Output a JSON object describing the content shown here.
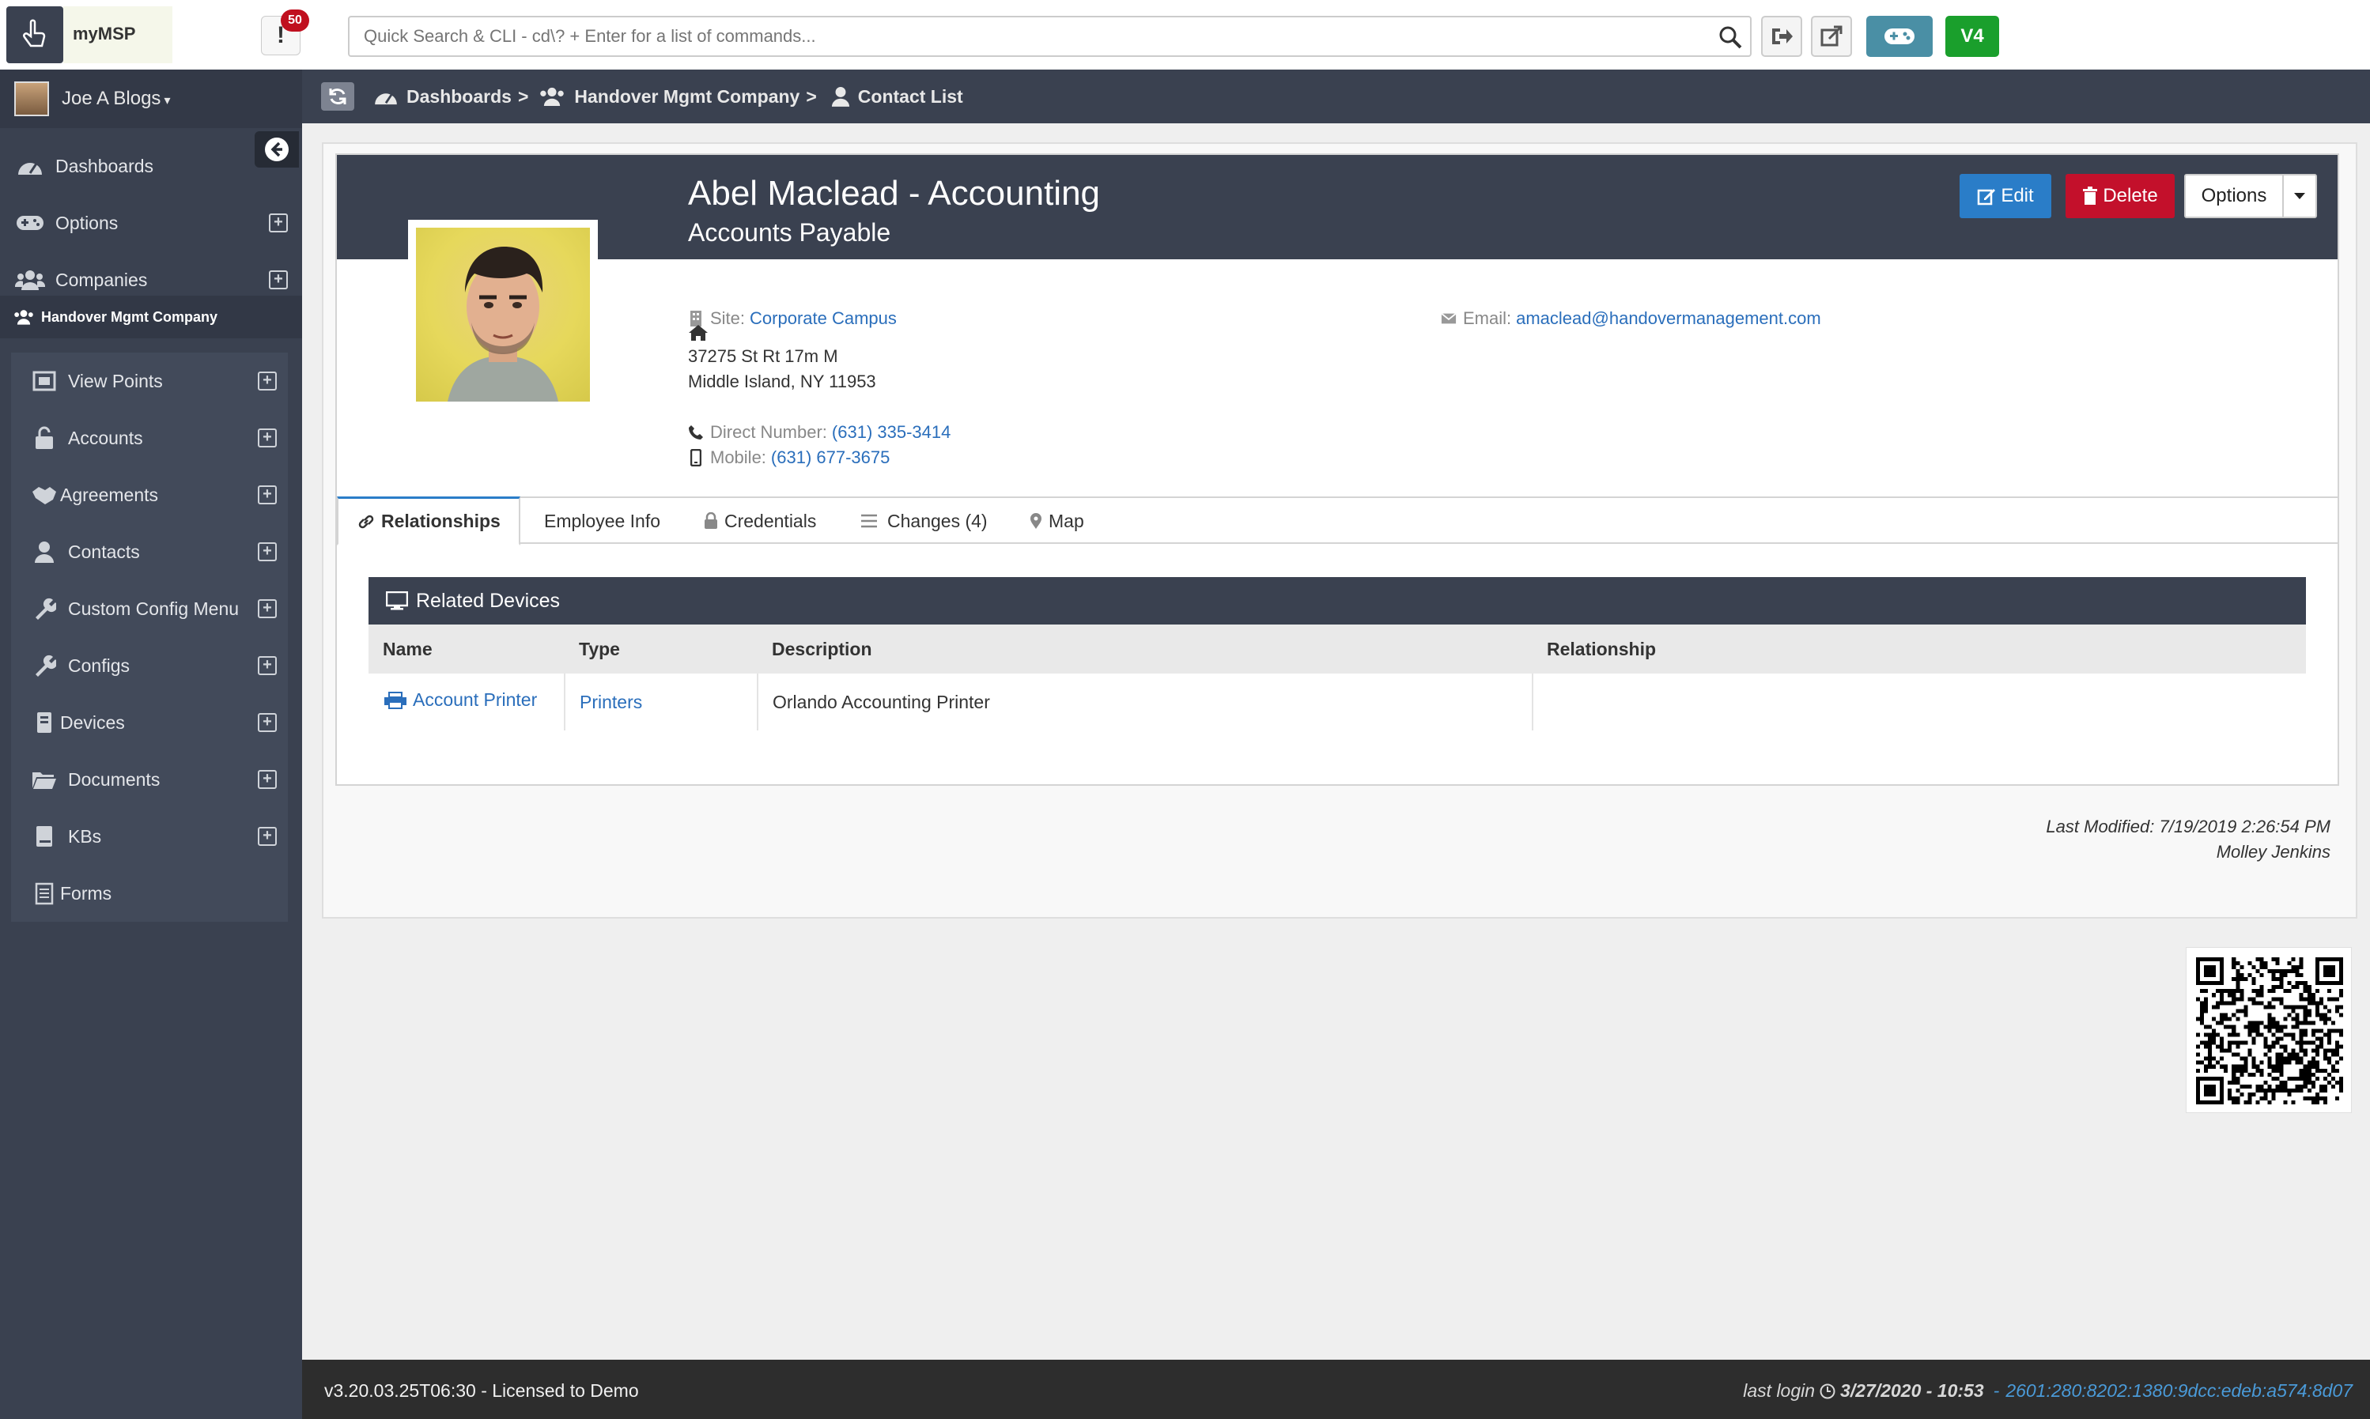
{
  "app": {
    "name": "myMSP",
    "notification_count": "50",
    "notification_symbol": "!",
    "version_badge": "V4",
    "brand_green": "#1a9f2c",
    "brand_dark": "#3a4150",
    "link_blue": "#2a6ebb"
  },
  "search": {
    "placeholder": "Quick Search & CLI - cd\\? + Enter for a list of commands..."
  },
  "user": {
    "name": "Joe A Blogs"
  },
  "sidebar": {
    "items": [
      {
        "label": "Dashboards",
        "icon": "dashboard-icon"
      },
      {
        "label": "Options",
        "icon": "gamepad-icon"
      },
      {
        "label": "Companies",
        "icon": "users-icon"
      }
    ],
    "company_header": "Handover Mgmt Company",
    "company_items": [
      {
        "label": "View Points",
        "icon": "viewpoints-icon"
      },
      {
        "label": "Accounts",
        "icon": "unlock-icon"
      },
      {
        "label": "Agreements",
        "icon": "handshake-icon"
      },
      {
        "label": "Contacts",
        "icon": "user-icon"
      },
      {
        "label": "Custom Config Menu",
        "icon": "wrench-icon"
      },
      {
        "label": "Configs",
        "icon": "wrench-icon"
      },
      {
        "label": "Devices",
        "icon": "devices-icon"
      },
      {
        "label": "Documents",
        "icon": "folder-icon"
      },
      {
        "label": "KBs",
        "icon": "book-icon"
      },
      {
        "label": "Forms",
        "icon": "forms-icon"
      }
    ]
  },
  "breadcrumb": {
    "dashboards": "Dashboards",
    "company": "Handover Mgmt Company",
    "page": "Contact List",
    "sep": ">"
  },
  "contact": {
    "first_name": "Abel",
    "last_name": "Maclead",
    "department": "- Accounting",
    "title": "Accounts Payable",
    "site_label": "Site:",
    "site": "Corporate Campus",
    "address_line1": "37275 St Rt 17m M",
    "address_line2": "Middle Island, NY 11953",
    "direct_label": "Direct Number:",
    "direct": "(631) 335-3414",
    "mobile_label": "Mobile:",
    "mobile": "(631) 677-3675",
    "email_label": "Email:",
    "email": "amaclead@handovermanagement.com"
  },
  "actions": {
    "edit": "Edit",
    "delete": "Delete",
    "options": "Options"
  },
  "tabs": [
    {
      "label": "Relationships",
      "icon": "link-icon"
    },
    {
      "label": "Employee Info",
      "icon": ""
    },
    {
      "label": "Credentials",
      "icon": "lock-icon"
    },
    {
      "label": "Changes (4)",
      "icon": "list-icon"
    },
    {
      "label": "Map",
      "icon": "map-marker-icon"
    }
  ],
  "related_devices": {
    "title": "Related Devices",
    "columns": [
      "Name",
      "Type",
      "Description",
      "Relationship"
    ],
    "rows": [
      {
        "name": "Account Printer",
        "type": "Printers",
        "description": "Orlando Accounting Printer",
        "relationship": ""
      }
    ]
  },
  "last_modified": {
    "line1": "Last Modified: 7/19/2019 2:26:54 PM",
    "line2": "Molley Jenkins"
  },
  "footer": {
    "version": "v3.20.03.25T06:30 - Licensed to Demo",
    "last_login_label": "last login",
    "last_login_time": "3/27/2020 - 10:53",
    "ip_prefix": "-",
    "ip": "2601:280:8202:1380:9dcc:edeb:a574:8d07"
  }
}
